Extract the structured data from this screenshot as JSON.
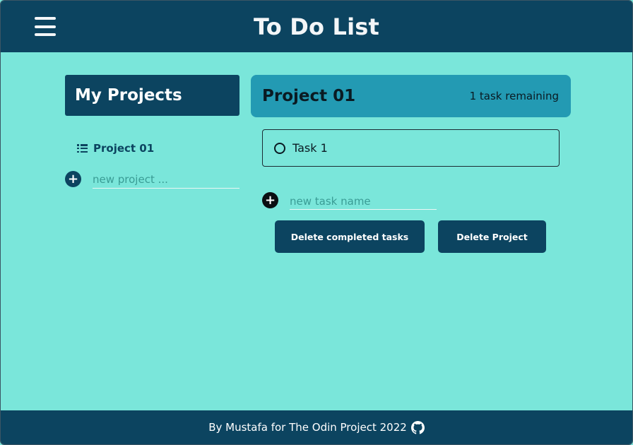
{
  "header": {
    "title": "To Do List",
    "menu_icon": "hamburger-menu-icon"
  },
  "sidebar": {
    "heading": "My Projects",
    "projects": [
      {
        "label": "Project 01",
        "icon": "list-icon"
      }
    ],
    "new_project": {
      "placeholder": "new project ...",
      "value": ""
    }
  },
  "main": {
    "project_title": "Project 01",
    "remaining": "1 task remaining",
    "tasks": [
      {
        "label": "Task 1",
        "completed": false
      }
    ],
    "new_task": {
      "placeholder": "new task name",
      "value": ""
    },
    "buttons": {
      "delete_completed": "Delete completed tasks",
      "delete_project": "Delete Project"
    }
  },
  "footer": {
    "text": "By Mustafa for The Odin Project 2022",
    "icon": "github-icon"
  },
  "colors": {
    "primary": "#0c4460",
    "background": "#7ae6da",
    "accent": "#239ab3"
  }
}
